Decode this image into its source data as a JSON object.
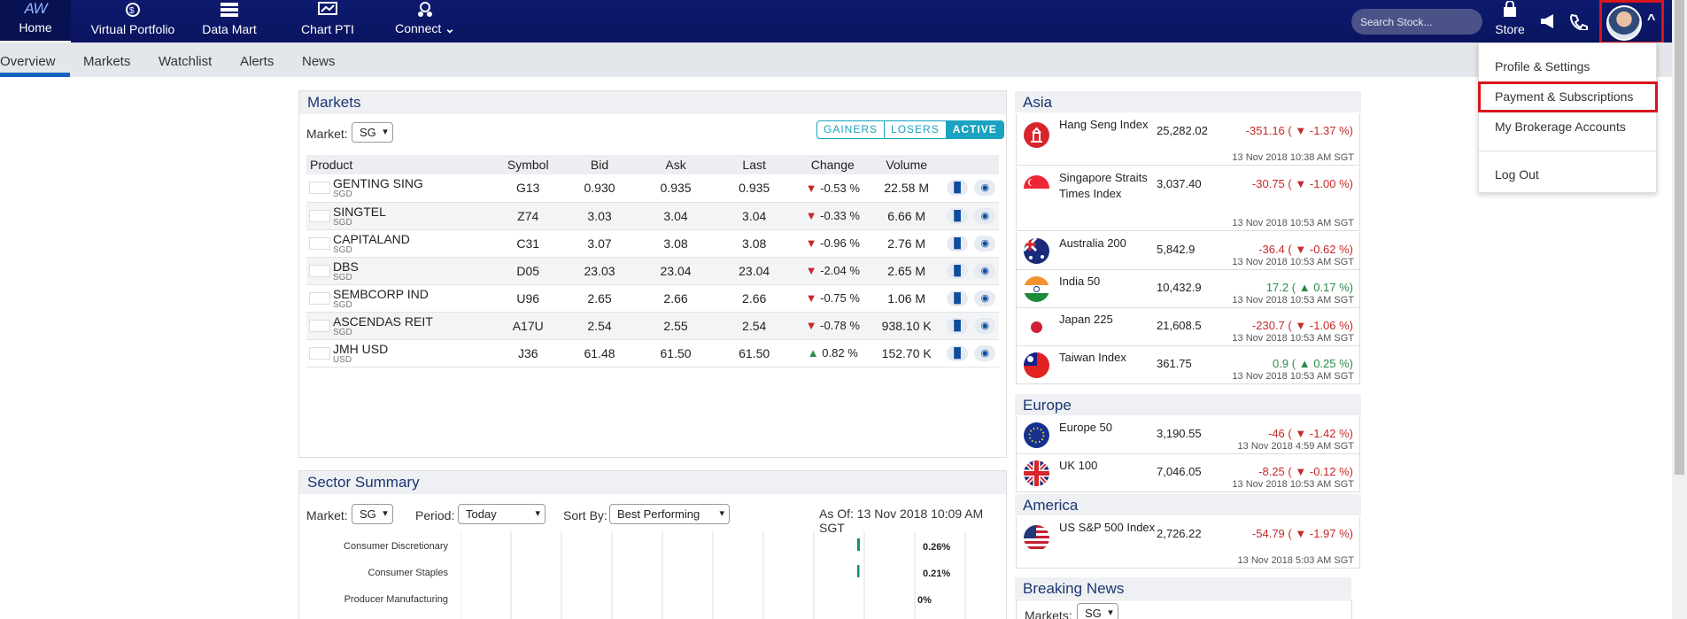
{
  "nav": {
    "logo": "AW",
    "items": [
      {
        "label": "Home"
      },
      {
        "label": "Virtual Portfolio"
      },
      {
        "label": "Data Mart"
      },
      {
        "label": "Chart PTI"
      },
      {
        "label": "Connect"
      }
    ],
    "search_placeholder": "Search Stock...",
    "store": "Store"
  },
  "subnav": {
    "tabs": [
      "Overview",
      "Markets",
      "Watchlist",
      "Alerts",
      "News"
    ]
  },
  "markets": {
    "title": "Markets",
    "market_label": "Market:",
    "market_value": "SG",
    "toggles": [
      "GAINERS",
      "LOSERS",
      "ACTIVE"
    ],
    "columns": [
      "Product",
      "Symbol",
      "Bid",
      "Ask",
      "Last",
      "Change",
      "Volume"
    ],
    "rows": [
      {
        "name": "GENTING SING",
        "cur": "SGD",
        "sym": "G13",
        "bid": "0.930",
        "ask": "0.935",
        "last": "0.935",
        "chg": "-0.53 %",
        "dir": "down",
        "vol": "22.58 M"
      },
      {
        "name": "SINGTEL",
        "cur": "SGD",
        "sym": "Z74",
        "bid": "3.03",
        "ask": "3.04",
        "last": "3.04",
        "chg": "-0.33 %",
        "dir": "down",
        "vol": "6.66 M"
      },
      {
        "name": "CAPITALAND",
        "cur": "SGD",
        "sym": "C31",
        "bid": "3.07",
        "ask": "3.08",
        "last": "3.08",
        "chg": "-0.96 %",
        "dir": "down",
        "vol": "2.76 M"
      },
      {
        "name": "DBS",
        "cur": "SGD",
        "sym": "D05",
        "bid": "23.03",
        "ask": "23.04",
        "last": "23.04",
        "chg": "-2.04 %",
        "dir": "down",
        "vol": "2.65 M"
      },
      {
        "name": "SEMBCORP IND",
        "cur": "SGD",
        "sym": "U96",
        "bid": "2.65",
        "ask": "2.66",
        "last": "2.66",
        "chg": "-0.75 %",
        "dir": "down",
        "vol": "1.06 M"
      },
      {
        "name": "ASCENDAS REIT",
        "cur": "SGD",
        "sym": "A17U",
        "bid": "2.54",
        "ask": "2.55",
        "last": "2.54",
        "chg": "-0.78 %",
        "dir": "down",
        "vol": "938.10 K"
      },
      {
        "name": "JMH USD",
        "cur": "USD",
        "sym": "J36",
        "bid": "61.48",
        "ask": "61.50",
        "last": "61.50",
        "chg": "0.82 %",
        "dir": "up",
        "vol": "152.70 K"
      }
    ]
  },
  "sector": {
    "title": "Sector Summary",
    "market_label": "Market:",
    "market_value": "SG",
    "period_label": "Period:",
    "period_value": "Today",
    "sort_label": "Sort By:",
    "sort_value": "Best Performing",
    "asof": "As Of: 13 Nov 2018 10:09 AM SGT",
    "bars": [
      {
        "label": "Consumer Discretionary",
        "value": "0.26%"
      },
      {
        "label": "Consumer Staples",
        "value": "0.21%"
      },
      {
        "label": "Producer Manufacturing",
        "value": "0%"
      }
    ]
  },
  "asia": {
    "title": "Asia",
    "rows": [
      {
        "name": "Hang Seng Index",
        "value": "25,282.02",
        "chg": "-351.16 (",
        "pct": "-1.37 %)",
        "dir": "down",
        "time": "13 Nov 2018 10:38 AM SGT"
      },
      {
        "name": "Singapore Straits Times Index",
        "value": "3,037.40",
        "chg": "-30.75 (",
        "pct": "-1.00 %)",
        "dir": "down",
        "time": "13 Nov 2018 10:53 AM SGT"
      },
      {
        "name": "Australia 200",
        "value": "5,842.9",
        "chg": "-36.4 (",
        "pct": "-0.62 %)",
        "dir": "down",
        "time": "13 Nov 2018 10:53 AM SGT"
      },
      {
        "name": "India 50",
        "value": "10,432.9",
        "chg": "17.2 (",
        "pct": "0.17 %)",
        "dir": "up",
        "time": "13 Nov 2018 10:53 AM SGT"
      },
      {
        "name": "Japan 225",
        "value": "21,608.5",
        "chg": "-230.7 (",
        "pct": "-1.06 %)",
        "dir": "down",
        "time": "13 Nov 2018 10:53 AM SGT"
      },
      {
        "name": "Taiwan Index",
        "value": "361.75",
        "chg": "0.9 (",
        "pct": "0.25 %)",
        "dir": "up",
        "time": "13 Nov 2018 10:53 AM SGT"
      }
    ]
  },
  "europe": {
    "title": "Europe",
    "rows": [
      {
        "name": "Europe 50",
        "value": "3,190.55",
        "chg": "-46 (",
        "pct": "-1.42 %)",
        "dir": "down",
        "time": "13 Nov 2018 4:59 AM SGT"
      },
      {
        "name": "UK 100",
        "value": "7,046.05",
        "chg": "-8.25 (",
        "pct": "-0.12 %)",
        "dir": "down",
        "time": "13 Nov 2018 10:53 AM SGT"
      }
    ]
  },
  "america": {
    "title": "America",
    "rows": [
      {
        "name": "US S&P 500 Index",
        "value": "2,726.22",
        "chg": "-54.79 (",
        "pct": "-1.97 %)",
        "dir": "down",
        "time": "13 Nov 2018 5:03 AM SGT"
      }
    ]
  },
  "news": {
    "title": "Breaking News",
    "market_label": "Markets:",
    "market_value": "SG"
  },
  "dropdown": {
    "items": [
      "Profile & Settings",
      "Payment & Subscriptions",
      "My Brokerage Accounts",
      "Log Out"
    ]
  }
}
